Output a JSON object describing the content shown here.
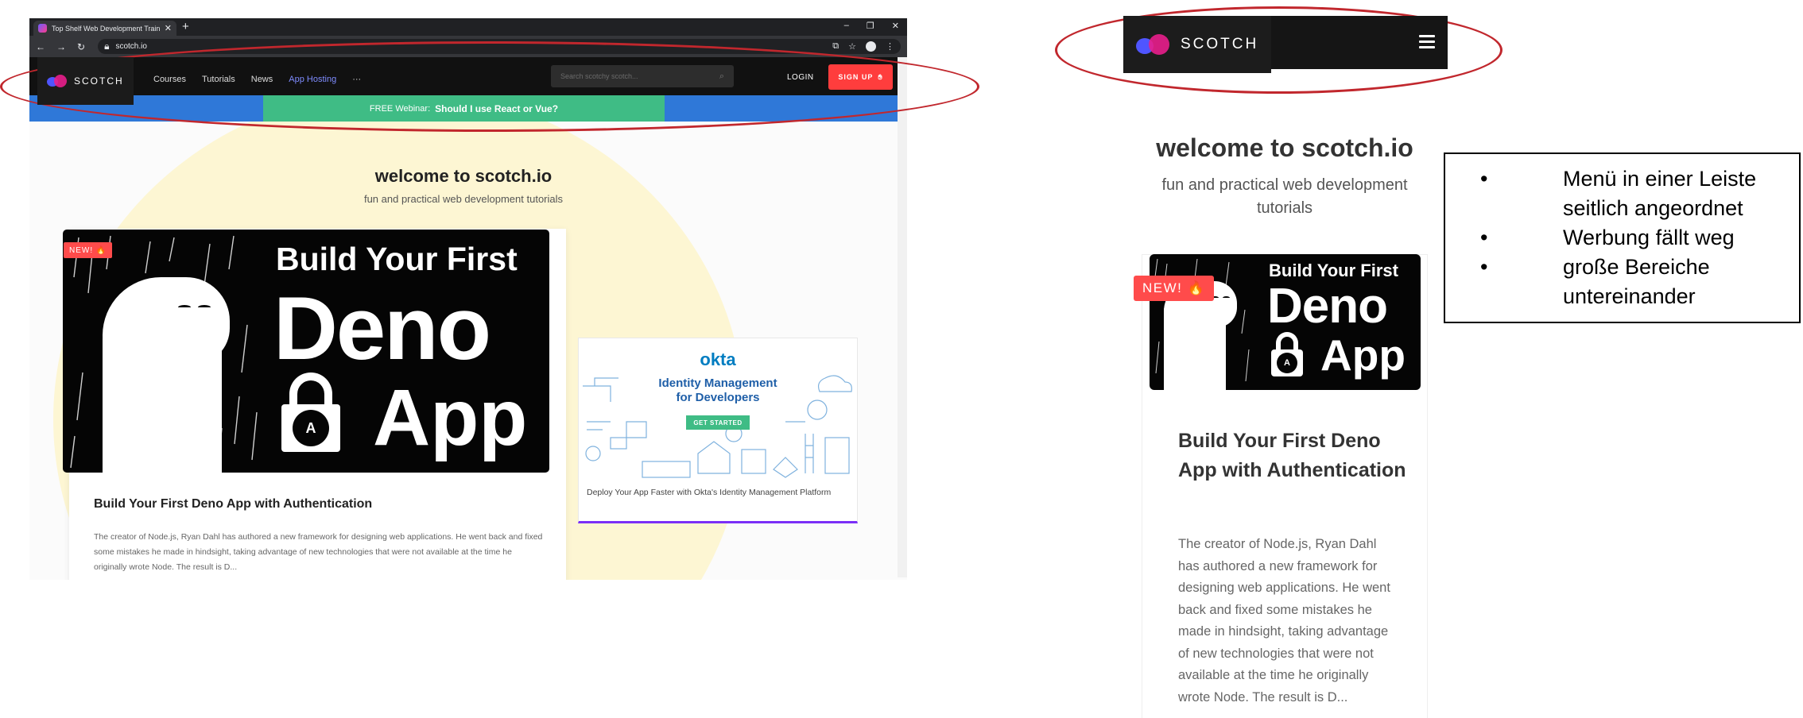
{
  "browser": {
    "tab_title": "Top Shelf Web Development Training",
    "url": "scotch.io"
  },
  "site_nav": {
    "logo": "SCOTCH",
    "links": [
      "Courses",
      "Tutorials",
      "News",
      "App Hosting",
      "···"
    ],
    "search_placeholder": "Search scotchy scotch...",
    "login": "LOGIN",
    "signup": "SIGN UP"
  },
  "promo": {
    "prefix": "FREE Webinar:",
    "title": "Should I use React or Vue?"
  },
  "welcome": {
    "title": "welcome to scotch.io",
    "subtitle": "fun and practical web development tutorials"
  },
  "featured": {
    "badge": "NEW! 🔥",
    "hero_line1": "Build Your First",
    "hero_line2": "Deno",
    "hero_line3": "App",
    "title": "Build Your First Deno App with Authentication",
    "excerpt": "The creator of Node.js, Ryan Dahl has authored a new framework for designing web applications. He went back and fixed some mistakes he made in hindsight, taking advantage of new technologies that were not available at the time he originally wrote Node. The result is D..."
  },
  "ad": {
    "brand": "okta",
    "headline": "Identity Management for Developers",
    "cta": "GET STARTED",
    "caption": "Deploy Your App Faster with Okta's Identity Management Platform"
  },
  "mobile": {
    "logo": "SCOTCH",
    "welcome_title": "welcome to scotch.io",
    "welcome_subtitle": "fun and practical web development tutorials",
    "badge": "NEW! 🔥",
    "hero_line1": "Build Your First",
    "hero_line2": "Deno",
    "hero_line3": "App",
    "title": "Build Your First Deno App with Authentication",
    "excerpt": "The creator of Node.js, Ryan Dahl has authored a new framework for designing web applications. He went back and fixed some mistakes he made in hindsight, taking advantage of new technologies that were not available at the time he originally wrote Node. The result is D..."
  },
  "notes": [
    "Menü in einer Leiste seitlich angeordnet",
    "Werbung fällt weg",
    "große Bereiche untereinander"
  ],
  "colors": {
    "annotation_red": "#c1272d",
    "signup_red": "#ff3d3d",
    "webinar_green": "#3fbc85",
    "promo_blue": "#2f78d8",
    "active_link": "#7f8cff"
  }
}
